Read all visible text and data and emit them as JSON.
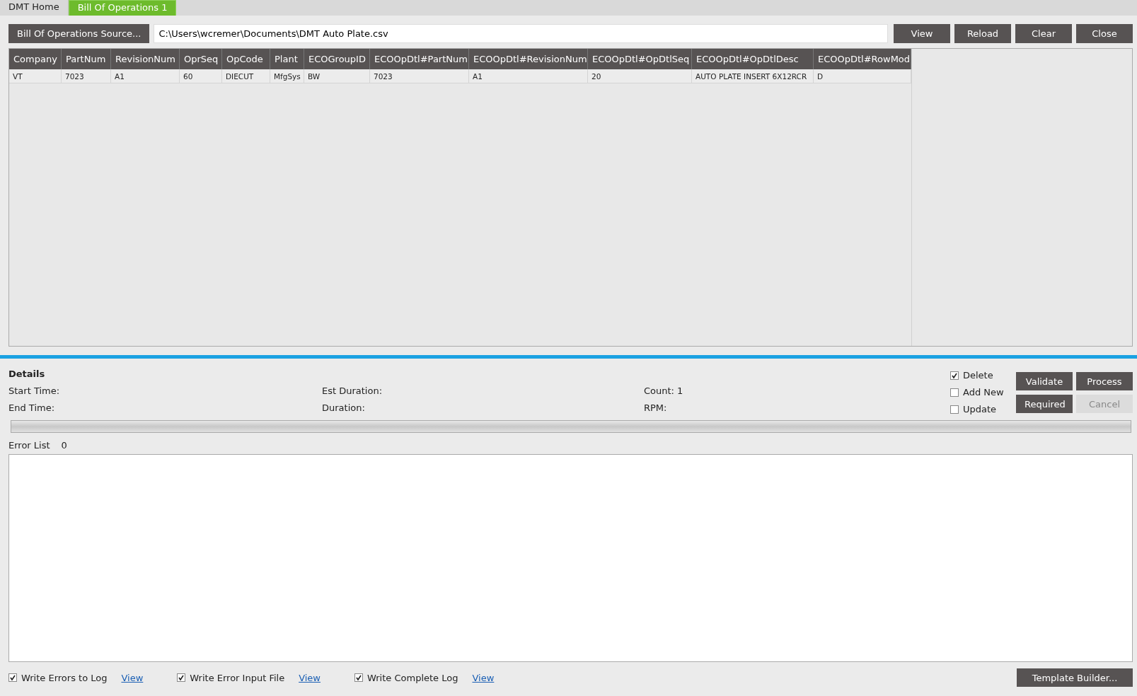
{
  "tabs": [
    {
      "label": "DMT Home",
      "selected": false
    },
    {
      "label": "Bill Of Operations 1",
      "selected": true
    }
  ],
  "source": {
    "button": "Bill Of Operations Source...",
    "path": "C:\\Users\\wcremer\\Documents\\DMT Auto Plate.csv"
  },
  "toolbar": [
    "View",
    "Reload",
    "Clear",
    "Close"
  ],
  "table": {
    "columns": [
      "Company",
      "PartNum",
      "RevisionNum",
      "OprSeq",
      "OpCode",
      "Plant",
      "ECOGroupID",
      "ECOOpDtl#PartNum",
      "ECOOpDtl#RevisionNum",
      "ECOOpDtl#OpDtlSeq",
      "ECOOpDtl#OpDtlDesc",
      "ECOOpDtl#RowMod"
    ],
    "rows": [
      [
        "VT",
        "7023",
        "A1",
        "60",
        "DIECUT",
        "MfgSys",
        "BW",
        "7023",
        "A1",
        "20",
        "AUTO PLATE INSERT 6X12RCR",
        "D"
      ]
    ]
  },
  "details": {
    "title": "Details",
    "fields": [
      [
        "Start Time:",
        "Est Duration:",
        "Count: 1"
      ],
      [
        "End Time:",
        "Duration:",
        "RPM:"
      ]
    ],
    "options": [
      {
        "label": "Delete",
        "checked": true
      },
      {
        "label": "Add New",
        "checked": false
      },
      {
        "label": "Update",
        "checked": false
      }
    ],
    "actions": [
      {
        "label": "Validate",
        "disabled": false
      },
      {
        "label": "Process",
        "disabled": false
      },
      {
        "label": "Required",
        "disabled": false
      },
      {
        "label": "Cancel",
        "disabled": true
      }
    ]
  },
  "progress": {
    "level": 0
  },
  "error_list": {
    "label": "Error List",
    "count": "0"
  },
  "footer": {
    "logs": [
      {
        "label": "Write Errors to Log",
        "checked": true,
        "link": "View"
      },
      {
        "label": "Write Error Input File",
        "checked": true,
        "link": "View"
      },
      {
        "label": "Write Complete Log",
        "checked": true,
        "link": "View"
      }
    ],
    "button": "Template Builder..."
  }
}
